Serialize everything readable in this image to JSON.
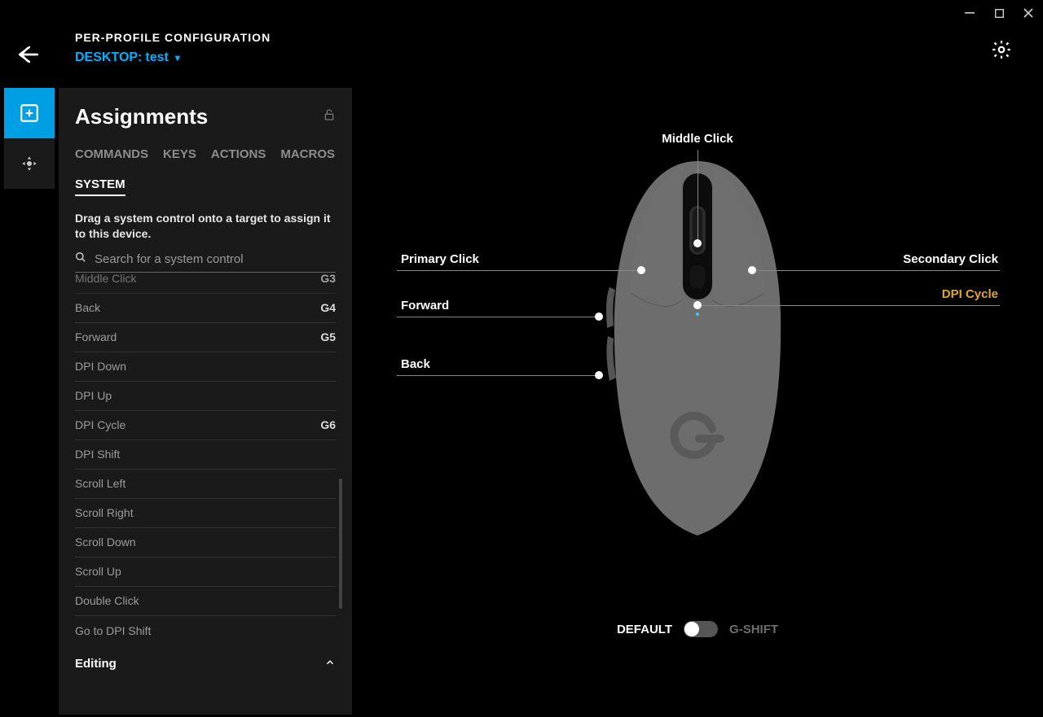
{
  "window": {
    "title": "PER-PROFILE CONFIGURATION",
    "profile_prefix": "DESKTOP:",
    "profile_name": "test"
  },
  "panel": {
    "title": "Assignments",
    "tabs": [
      "COMMANDS",
      "KEYS",
      "ACTIONS",
      "MACROS",
      "SYSTEM"
    ],
    "active_tab": "SYSTEM",
    "hint": "Drag a system control onto a target to assign it to this device.",
    "search_placeholder": "Search for a system control",
    "items": [
      {
        "label": "Middle Click",
        "gkey": "G3"
      },
      {
        "label": "Back",
        "gkey": "G4"
      },
      {
        "label": "Forward",
        "gkey": "G5"
      },
      {
        "label": "DPI Down",
        "gkey": ""
      },
      {
        "label": "DPI Up",
        "gkey": ""
      },
      {
        "label": "DPI Cycle",
        "gkey": "G6"
      },
      {
        "label": "DPI Shift",
        "gkey": ""
      },
      {
        "label": "Scroll Left",
        "gkey": ""
      },
      {
        "label": "Scroll Right",
        "gkey": ""
      },
      {
        "label": "Scroll Down",
        "gkey": ""
      },
      {
        "label": "Scroll Up",
        "gkey": ""
      },
      {
        "label": "Double Click",
        "gkey": ""
      },
      {
        "label": "Go to DPI Shift",
        "gkey": ""
      }
    ],
    "section_header": "Editing"
  },
  "diagram": {
    "labels": {
      "middle": "Middle Click",
      "primary": "Primary Click",
      "secondary": "Secondary Click",
      "forward": "Forward",
      "back": "Back",
      "dpi": "DPI Cycle"
    },
    "mode_left": "DEFAULT",
    "mode_right": "G-SHIFT"
  }
}
